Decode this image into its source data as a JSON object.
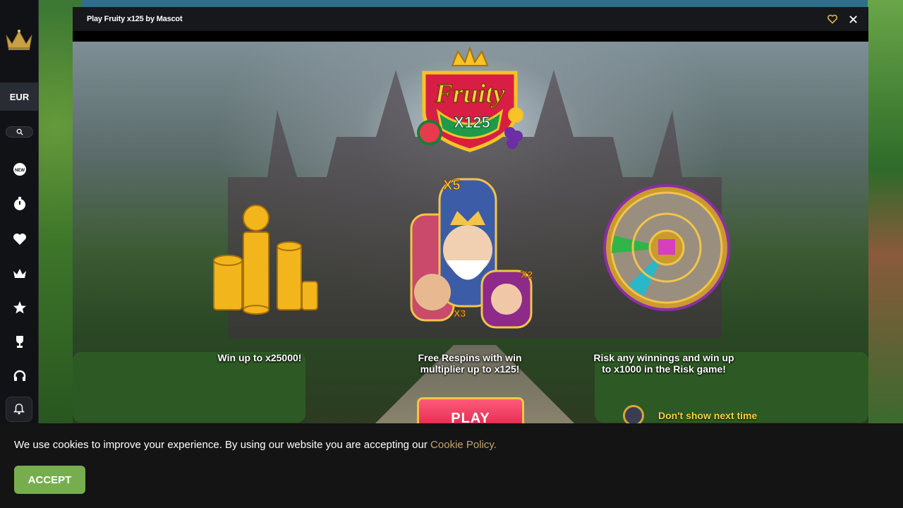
{
  "sidebar": {
    "currency": "EUR",
    "icons": [
      "new-games-icon",
      "timer-icon",
      "heart-icon",
      "crown-icon",
      "star-icon",
      "trophy-icon",
      "headset-icon",
      "bell-icon"
    ]
  },
  "game": {
    "title": "Play Fruity x125 by Mascot",
    "logo_text": "Fruity",
    "logo_sub": "X125",
    "features": [
      {
        "text": "Win up to x25000!"
      },
      {
        "text": "Free Respins with win multiplier up to x125!"
      },
      {
        "text": "Risk any winnings and win up to x1000 in the Risk game!"
      }
    ],
    "multipliers": [
      "X5",
      "X2",
      "X3"
    ],
    "play_label": "PLAY",
    "dont_show_label": "Don't show next time"
  },
  "cookie": {
    "text": "We use cookies to improve your experience. By using our website you are accepting our",
    "link": "Cookie Policy.",
    "accept_label": "ACCEPT"
  },
  "colors": {
    "accent": "#f5c543",
    "accept": "#76ae4f",
    "link": "#c8a36a"
  }
}
